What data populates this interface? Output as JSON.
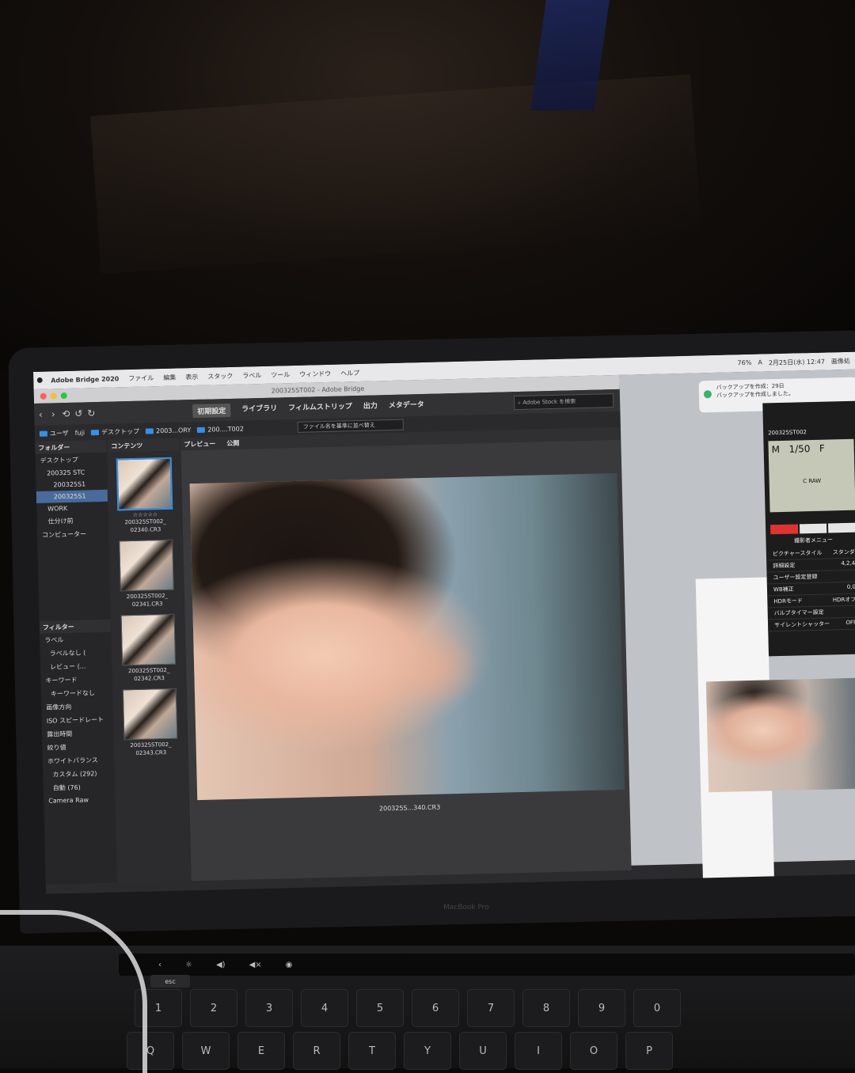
{
  "menubar": {
    "app": "Adobe Bridge 2020",
    "items": [
      "ファイル",
      "編集",
      "表示",
      "スタック",
      "ラベル",
      "ツール",
      "ウィンドウ",
      "ヘルプ"
    ],
    "status": [
      "76%",
      "A",
      "2月25日(水) 12:47",
      "画像処"
    ]
  },
  "window": {
    "title": "200325ST002 - Adobe Bridge"
  },
  "toolbar": {
    "workspaces": [
      "初期設定",
      "ライブラリ",
      "フィルムストリップ",
      "出力",
      "メタデータ"
    ],
    "search_placeholder": "Adobe Stock を検索"
  },
  "pathbar": {
    "crumbs": [
      "ユーザ",
      "fuji",
      "デスクトップ",
      "2003...ORY",
      "200....T002"
    ],
    "sort_label": "ファイル名を基準に並べ替え"
  },
  "panels": {
    "folder_tab": "フォルダー",
    "content_tab": "コンテンツ",
    "preview_tab": "プレビュー",
    "publish_tab": "公開",
    "filter_tab": "フィルター"
  },
  "tree": [
    "デスクトップ",
    "200325 STC",
    "200325S1",
    "200325S1",
    "WORK",
    "仕分け前",
    "コンピューター"
  ],
  "filters": [
    "ラベル",
    "ラベルなし (",
    "レビュー (...",
    "キーワード",
    "キーワードなし",
    "画像方向",
    "ISO スピードレート",
    "露出時間",
    "絞り値",
    "ホワイトバランス",
    "カスタム (292)",
    "自動 (76)",
    "Camera Raw"
  ],
  "thumbnails": [
    {
      "stars": "☆☆☆☆☆",
      "name1": "200325ST002_",
      "name2": "02340.CR3"
    },
    {
      "stars": "",
      "name1": "200325ST002_",
      "name2": "02341.CR3"
    },
    {
      "stars": "",
      "name1": "200325ST002_",
      "name2": "02342.CR3"
    },
    {
      "stars": "",
      "name1": "200325ST002_",
      "name2": "02343.CR3"
    }
  ],
  "preview": {
    "caption": "200325S...340.CR3"
  },
  "notification": {
    "title": "バックアップを作成：29日",
    "body": "バックアップを作成しました。"
  },
  "camera": {
    "folder": "200325ST002",
    "mode": "M",
    "shutter": "1/50",
    "fvalue": "F",
    "format": "C RAW",
    "menu_title": "撮影者メニュー",
    "rows": [
      {
        "k": "ピクチャースタイル",
        "v": "スタンダ"
      },
      {
        "k": "詳細設定",
        "v": "4,2,4"
      },
      {
        "k": "ユーザー設定登録",
        "v": ""
      },
      {
        "k": "WB補正",
        "v": "0,0"
      },
      {
        "k": "HDRモード",
        "v": "HDRオフ"
      },
      {
        "k": "バルブタイマー設定",
        "v": ""
      },
      {
        "k": "サイレントシャッター",
        "v": "OFF"
      }
    ]
  },
  "laptop": {
    "brand": "MacBook Pro"
  },
  "keyboard": {
    "esc": "esc",
    "row1": [
      "1",
      "2",
      "3",
      "4",
      "5",
      "6",
      "7",
      "8",
      "9",
      "0"
    ],
    "row2": [
      "Q",
      "W",
      "E",
      "R",
      "T",
      "Y",
      "U",
      "I",
      "O",
      "P"
    ]
  }
}
